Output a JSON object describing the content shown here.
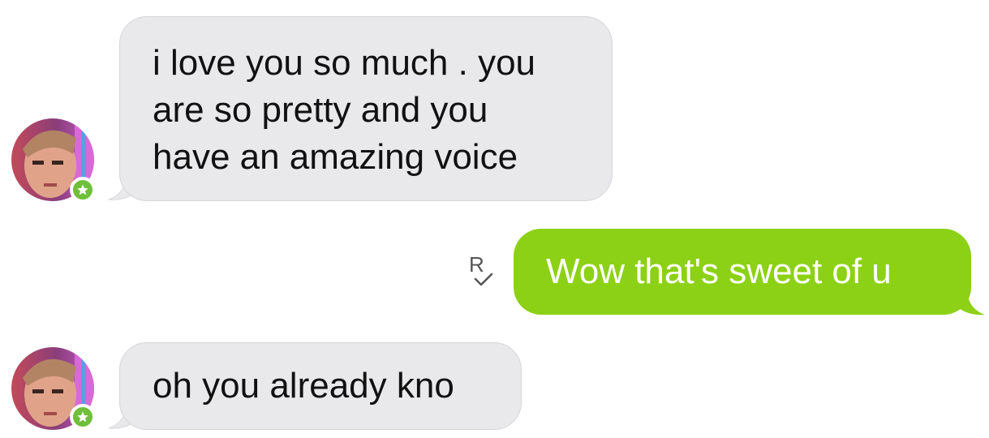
{
  "conversation": {
    "messages": [
      {
        "direction": "incoming",
        "lines": [
          "i love you so much . you",
          "are so pretty and you",
          "have an amazing voice"
        ],
        "avatar_icon": "contact-avatar",
        "badge_icon": "star-badge-icon"
      },
      {
        "direction": "outgoing",
        "text": "Wow that's sweet of u",
        "status_icon": "read-receipt-icon",
        "status_text": "R"
      },
      {
        "direction": "incoming",
        "text": "oh you already kno",
        "avatar_icon": "contact-avatar",
        "badge_icon": "star-badge-icon"
      }
    ]
  },
  "colors": {
    "incoming_bubble": "#e9e9eb",
    "outgoing_bubble": "#8cd116",
    "badge": "#6fbf3a"
  }
}
